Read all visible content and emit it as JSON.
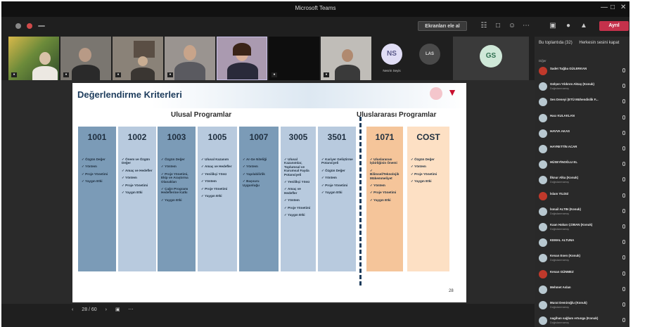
{
  "app": {
    "window_title": "Microsoft Teams"
  },
  "toolbar": {
    "share_label": "Ekranları ele al",
    "leave_label": "Ayrıl"
  },
  "participants_strip": [
    {
      "initials": "NS",
      "name": "Nesrin Seyis"
    },
    {
      "initials": "LAS",
      "name": ""
    },
    {
      "initials": "GS",
      "name": ""
    }
  ],
  "slide": {
    "title": "Değerlendirme Kriterleri",
    "group_national": "Ulusal Programlar",
    "group_international": "Uluslararası Programlar",
    "page_number": "28",
    "columns": [
      {
        "code": "1001",
        "color": "#7b9bb7",
        "items": [
          "Özgün Değer",
          "Yöntem",
          "Proje Yönetimi",
          "Yaygın Etki"
        ]
      },
      {
        "code": "1002",
        "color": "#b8cade",
        "items": [
          "Önem ve Özgün Değer",
          "Amaç ve Hedefler",
          "Yöntem",
          "Proje Yönetimi",
          "Yaygın Etki"
        ]
      },
      {
        "code": "1003",
        "color": "#7b9bb7",
        "items": [
          "Özgün Değer",
          "Yöntem",
          "Proje Yönetimi, Ekip ve Araştırma Olanakları",
          "Çağrı Programı Hedeflerine Katkı",
          "Yaygın Etki"
        ]
      },
      {
        "code": "1005",
        "color": "#b8cade",
        "items": [
          "Ulusal Kazanım",
          "Amaç ve Hedefler",
          "Yenilikçi Yönü",
          "Yöntem",
          "Proje Yönetimi",
          "Yaygın Etki"
        ]
      },
      {
        "code": "1007",
        "color": "#7b9bb7",
        "items": [
          "Ar-Ge Niteliği",
          "Yöntem",
          "Yapılabilirlik",
          "Başvuru Uygunluğu"
        ]
      },
      {
        "code": "3005",
        "color": "#b8cade",
        "items": [
          "Ulusal Kazanımlar, Toplumsal ve Kurumsal Fayda Potansiyeli",
          "Yenilikçi Yönü",
          "Amaç ve Hedefler",
          "Yöntem",
          "Proje Yönetimi",
          "Yaygın Etki"
        ]
      },
      {
        "code": "3501",
        "color": "#b8cade",
        "items": [
          "Kariyer Geliştirme Potansiyeli",
          "Özgün Değer",
          "Yöntem",
          "Proje Yönetimi",
          "Yaygın Etki"
        ]
      },
      {
        "code": "1071",
        "color": "#f5c59a",
        "items": [
          "Uluslararası İşbirliğinin Önemi",
          "Bilimsel/Teknolojik Mükemmeliyet",
          "Yöntem",
          "Proje Yönetimi",
          "Yaygın Etki"
        ]
      },
      {
        "code": "COST",
        "color": "#fde0c4",
        "items": [
          "Özgün Değer",
          "Yöntem",
          "Proje Yönetimi",
          "Yaygın Etki"
        ]
      }
    ]
  },
  "bottom_bar": {
    "page_indicator": "28 / 60"
  },
  "sidebar": {
    "header": "Bu toplantıda (32)",
    "action": "Herkesin sesini kapat",
    "section": "Diğer",
    "members": [
      {
        "name": "Sadet Tuğba GÜLERKAN",
        "sub": "",
        "color": "#c0392b"
      },
      {
        "name": "Gülşen Yıldırım Aktaş (Konuk)",
        "sub": "Doğrulanmamış",
        "color": "#b8c8d0"
      },
      {
        "name": "Ses Deneyi (ETÜ Mühendislik F...",
        "sub": "",
        "color": "#b8c8d0"
      },
      {
        "name": "Hacı KULAKLAN",
        "sub": "",
        "color": "#b8c8d0"
      },
      {
        "name": "HAVVA AKAS",
        "sub": "",
        "color": "#b8c8d0"
      },
      {
        "name": "HAYRETTİN ACAR",
        "sub": "",
        "color": "#b8c8d0"
      },
      {
        "name": "HÜSEYİNOĞLU EL",
        "sub": "",
        "color": "#b8c8d0"
      },
      {
        "name": "İlknur Alka (Konuk)",
        "sub": "Doğrulanmamış",
        "color": "#b8c8d0"
      },
      {
        "name": "İslam YILDIZ",
        "sub": "",
        "color": "#c0392b"
      },
      {
        "name": "İsmail ALTIN (Konuk)",
        "sub": "Doğrulanmamış",
        "color": "#b8c8d0"
      },
      {
        "name": "Kaan Hakan ÇOBAN (Konuk)",
        "sub": "Doğrulanmamış",
        "color": "#b8c8d0"
      },
      {
        "name": "KEMAL ALTUNA",
        "sub": "",
        "color": "#b8c8d0"
      },
      {
        "name": "Kenan Esen (Konuk)",
        "sub": "Doğrulanmamış",
        "color": "#b8c8d0"
      },
      {
        "name": "Kenan GÜNMEZ",
        "sub": "",
        "color": "#c0392b"
      },
      {
        "name": "Mehmet Aslan",
        "sub": "",
        "color": "#b8c8d0"
      },
      {
        "name": "Murat Demiroğlu (Konuk)",
        "sub": "Doğrulanmamış",
        "color": "#b8c8d0"
      },
      {
        "name": "nagihan sağlam ertunga (Konuk)",
        "sub": "Doğrulanmamış",
        "color": "#b8c8d0"
      }
    ]
  }
}
